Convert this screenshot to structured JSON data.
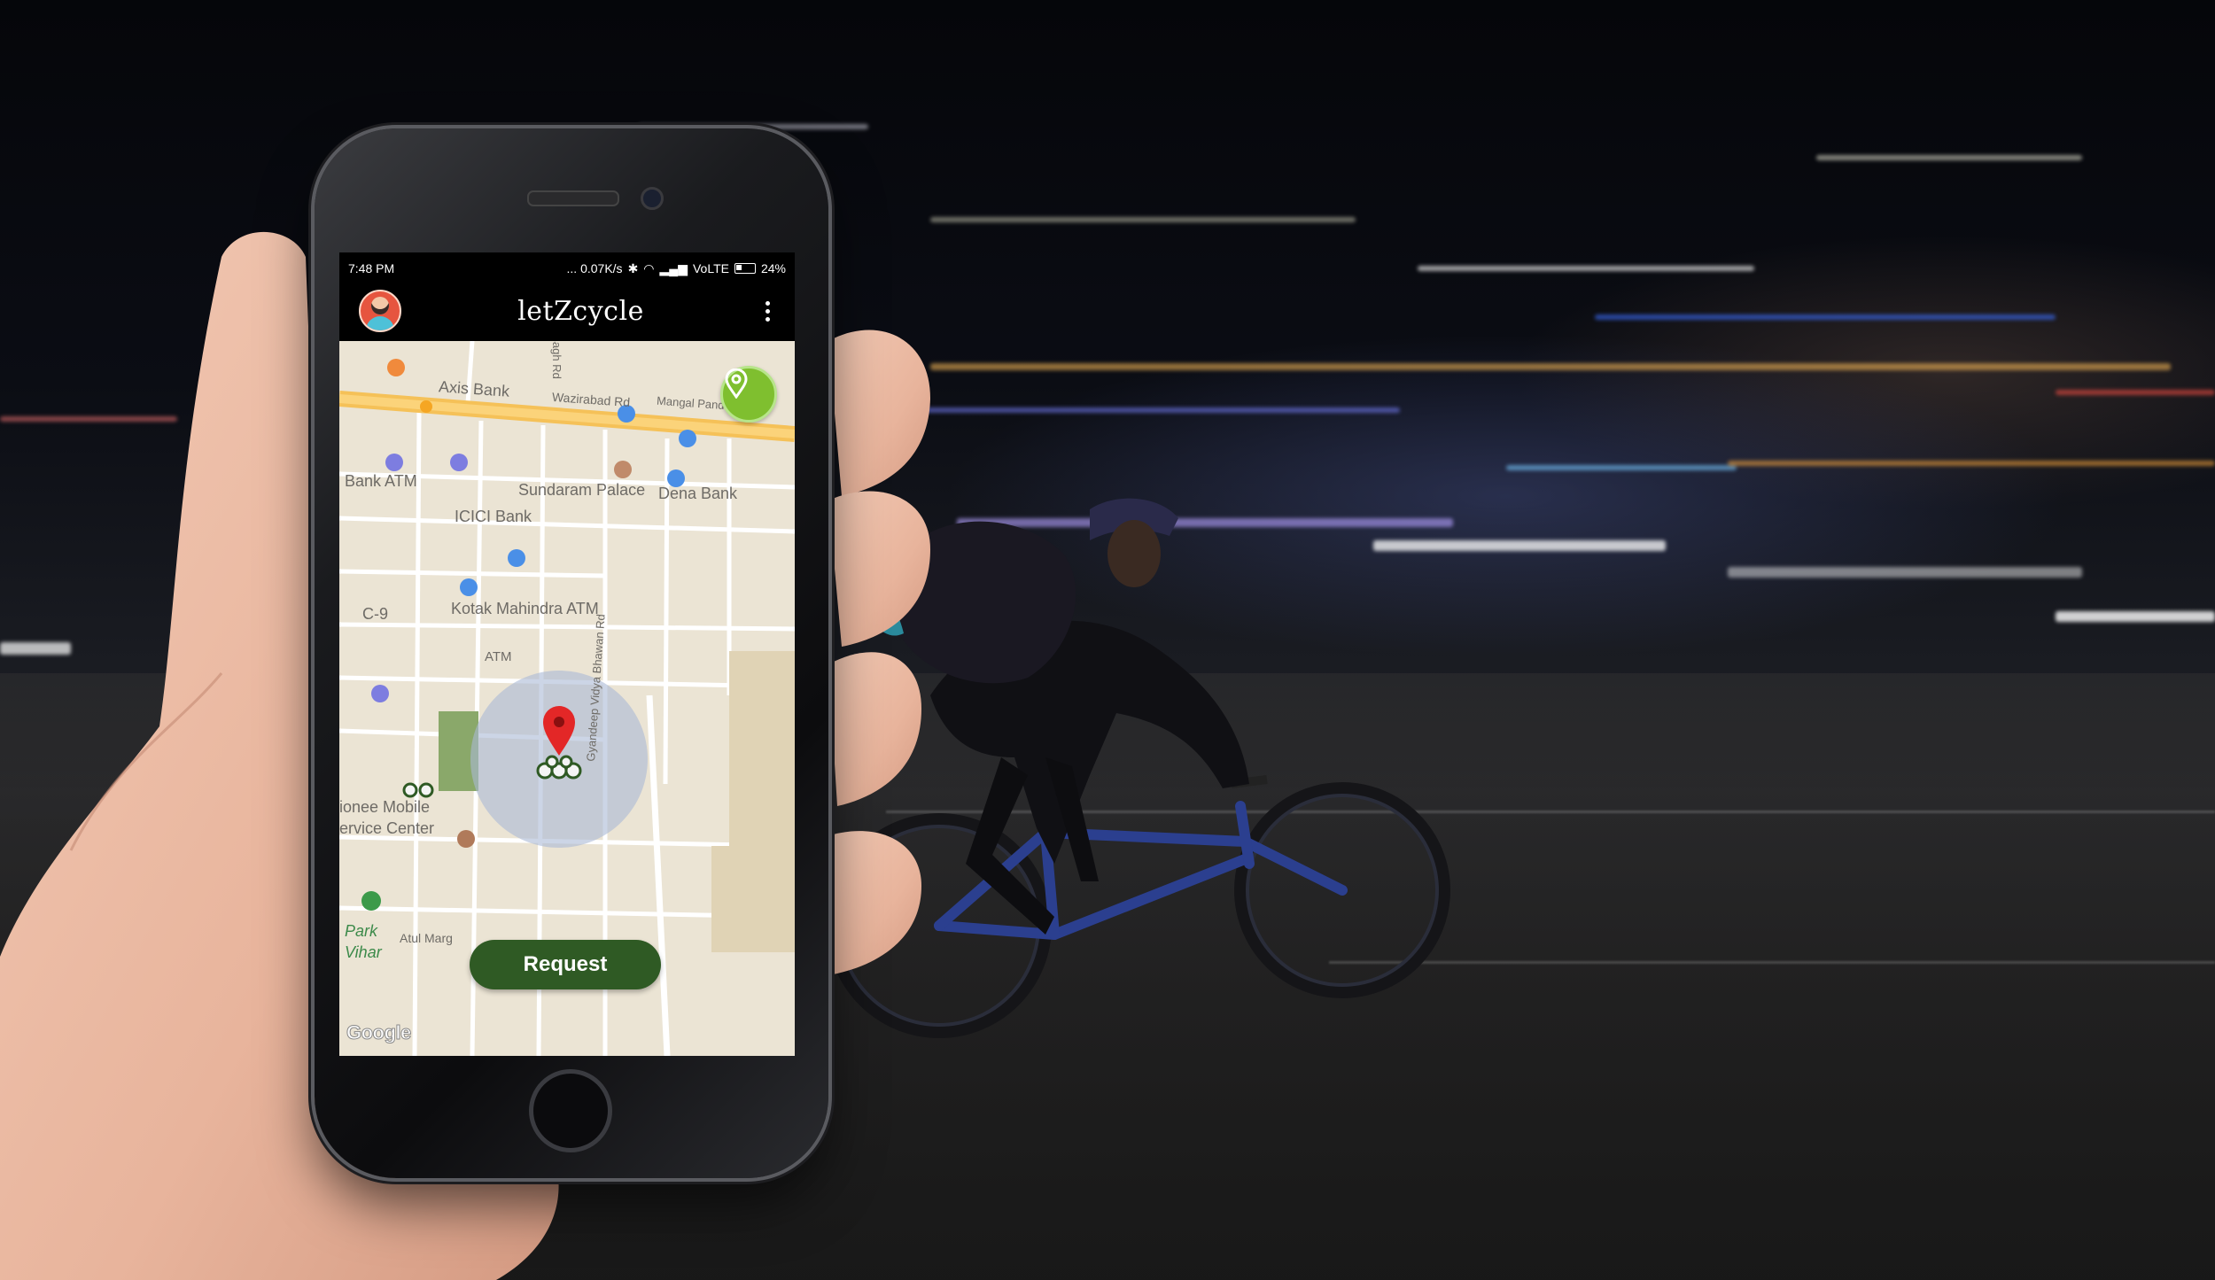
{
  "status_bar": {
    "time": "7:48 PM",
    "network_speed": "... 0.07K/s",
    "carrier": "VoLTE",
    "battery": "24%"
  },
  "app_bar": {
    "title": "letZcycle",
    "avatar_icon": "user-avatar-icon",
    "menu_icon": "more-vert-icon"
  },
  "map": {
    "labels": {
      "axis_bank": "Axis Bank",
      "wazirabad_rd": "Wazirabad Rd",
      "mangal_pandey_marg": "Mangal Pandey Marg",
      "bagh_rd": "Bagh Rd",
      "bank_atm": "Bank ATM",
      "sundaram_palace": "Sundaram Palace",
      "dena_bank": "Dena Bank",
      "icici_bank": "ICICI Bank",
      "kotak_atm": "Kotak Mahindra ATM",
      "c9": "C-9",
      "atm": "ATM",
      "mobile_service_1": "ionee Mobile",
      "mobile_service_2": "ervice Center",
      "park_1": "Park",
      "park_2": "Vihar",
      "atul_marg": "Atul Marg",
      "gyandeep_rd": "Gyandeep Vidya Bhawan Rd",
      "google": "Google"
    },
    "location_button_icon": "location-pin-icon",
    "pickup_marker_icon": "red-map-pin-icon",
    "bike_icon": "bicycle-icon"
  },
  "request_button": {
    "label": "Request"
  },
  "colors": {
    "map_bg": "#ebe4d4",
    "road_highlight": "#f5c158",
    "location_button": "#7fbf2f",
    "request_button": "#2f5a24",
    "radius_circle": "#aab9d6"
  }
}
